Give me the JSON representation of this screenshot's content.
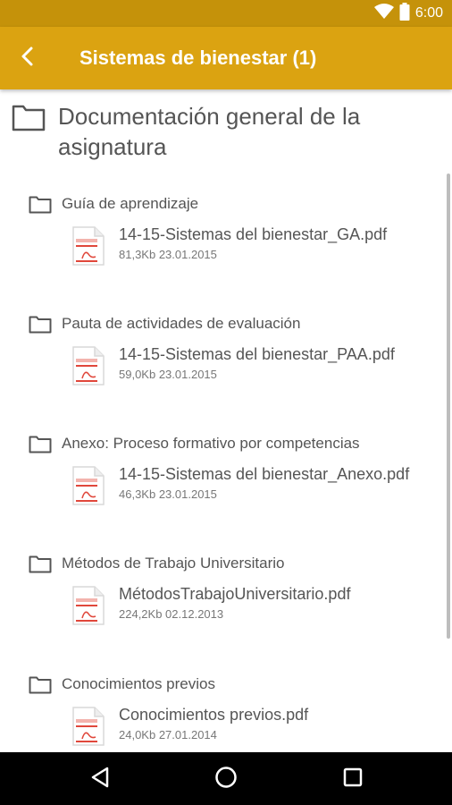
{
  "status": {
    "time": "6:00",
    "icons": [
      "wifi-icon",
      "battery-icon"
    ]
  },
  "header": {
    "title": "Sistemas de bienestar (1)",
    "back_icon": "back-arrow-icon"
  },
  "section": {
    "title": "Documentación general de la asignatura"
  },
  "folders": [
    {
      "label": "Guía de aprendizaje",
      "file": {
        "name": "14-15-Sistemas del bienestar_GA.pdf",
        "meta": "81,3Kb 23.01.2015"
      }
    },
    {
      "label": "Pauta de actividades de evaluación",
      "file": {
        "name": "14-15-Sistemas del bienestar_PAA.pdf",
        "meta": "59,0Kb 23.01.2015"
      }
    },
    {
      "label": "Anexo: Proceso formativo por competencias",
      "file": {
        "name": "14-15-Sistemas del bienestar_Anexo.pdf",
        "meta": "46,3Kb 23.01.2015"
      }
    },
    {
      "label": "Métodos de Trabajo Universitario",
      "file": {
        "name": "MétodosTrabajoUniversitario.pdf",
        "meta": "224,2Kb 02.12.2013"
      }
    },
    {
      "label": "Conocimientos previos",
      "file": {
        "name": "Conocimientos previos.pdf",
        "meta": "24,0Kb 27.01.2014"
      }
    }
  ],
  "navigation": {
    "buttons": [
      "back-nav-icon",
      "home-nav-icon",
      "recents-nav-icon"
    ]
  },
  "colors": {
    "status_bar": "#c5920a",
    "app_bar": "#dba311",
    "pdf_red": "#e0473b"
  }
}
